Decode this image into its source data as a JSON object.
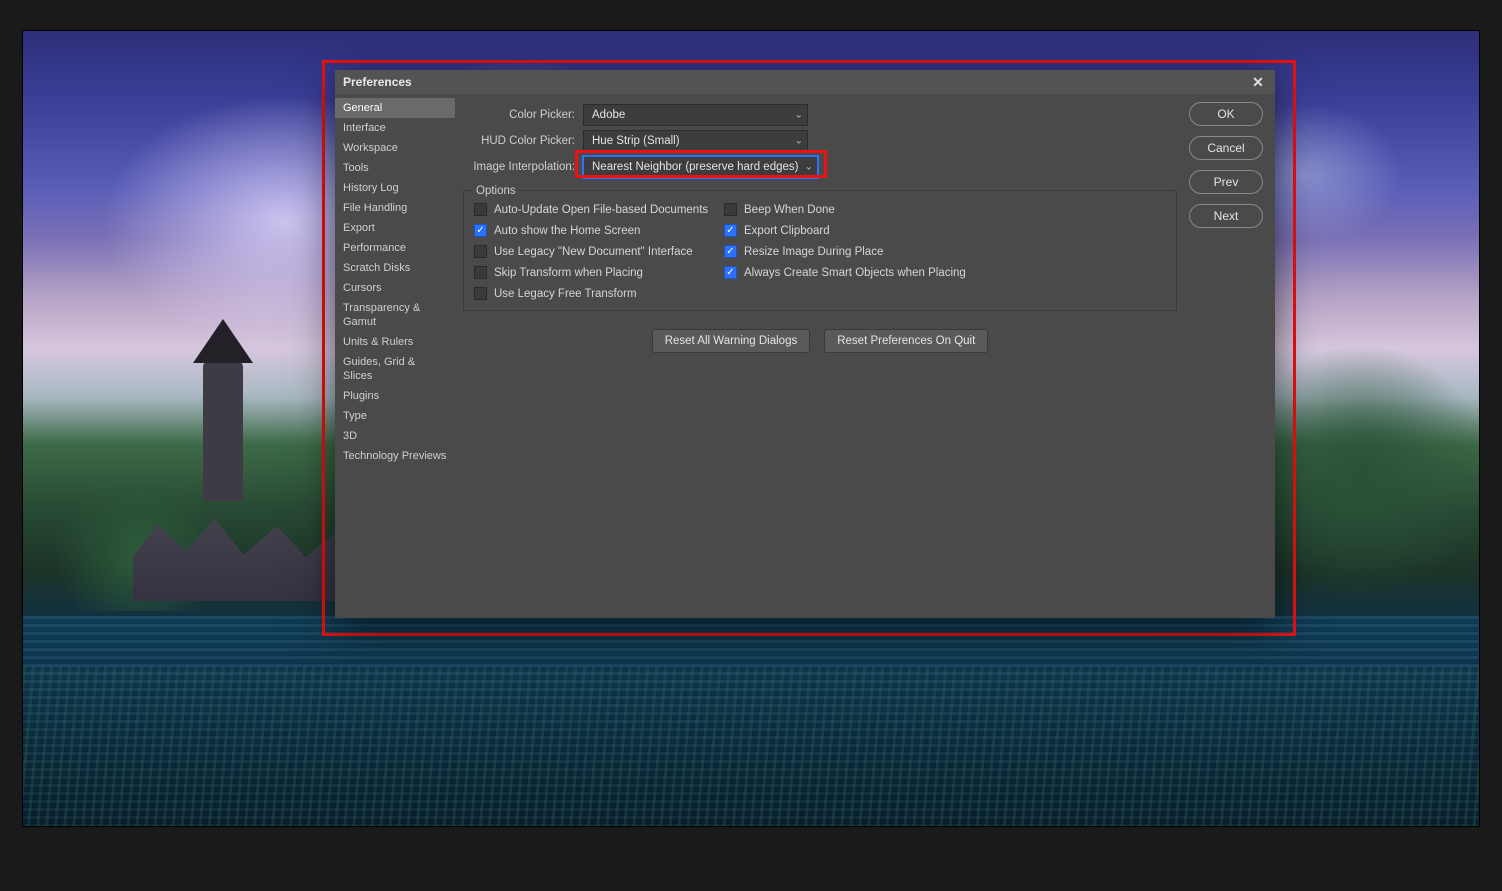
{
  "dialog": {
    "title": "Preferences",
    "sidebar": {
      "items": [
        "General",
        "Interface",
        "Workspace",
        "Tools",
        "History Log",
        "File Handling",
        "Export",
        "Performance",
        "Scratch Disks",
        "Cursors",
        "Transparency & Gamut",
        "Units & Rulers",
        "Guides, Grid & Slices",
        "Plugins",
        "Type",
        "3D",
        "Technology Previews"
      ],
      "active_index": 0
    },
    "buttons": {
      "ok": "OK",
      "cancel": "Cancel",
      "prev": "Prev",
      "next": "Next"
    },
    "form": {
      "color_picker": {
        "label": "Color Picker:",
        "value": "Adobe"
      },
      "hud_color_picker": {
        "label": "HUD Color Picker:",
        "value": "Hue Strip (Small)"
      },
      "image_interpolation": {
        "label": "Image Interpolation:",
        "value": "Nearest Neighbor (preserve hard edges)"
      }
    },
    "options": {
      "legend": "Options",
      "items": [
        {
          "label": "Auto-Update Open File-based Documents",
          "checked": false
        },
        {
          "label": "Beep When Done",
          "checked": false
        },
        {
          "label": "Auto show the Home Screen",
          "checked": true
        },
        {
          "label": "Export Clipboard",
          "checked": true
        },
        {
          "label": "Use Legacy \"New Document\" Interface",
          "checked": false
        },
        {
          "label": "Resize Image During Place",
          "checked": true
        },
        {
          "label": "Skip Transform when Placing",
          "checked": false
        },
        {
          "label": "Always Create Smart Objects when Placing",
          "checked": true
        },
        {
          "label": "Use Legacy Free Transform",
          "checked": false
        }
      ]
    },
    "footer_buttons": {
      "reset_warnings": "Reset All Warning Dialogs",
      "reset_on_quit": "Reset Preferences On Quit"
    }
  },
  "colors": {
    "annotation": "#e11",
    "accent": "#2a72ff"
  }
}
